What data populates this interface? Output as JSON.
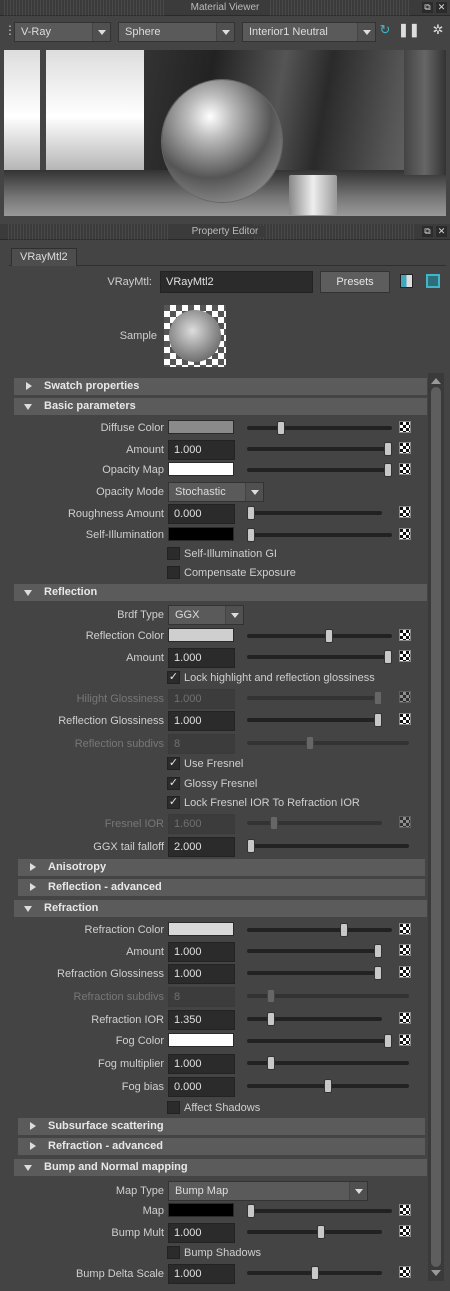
{
  "material_viewer": {
    "title": "Material Viewer",
    "renderer": "V-Ray",
    "geometry": "Sphere",
    "environment": "Interior1 Neutral"
  },
  "property_editor": {
    "title": "Property Editor",
    "tab": "VRayMtl2",
    "type_label": "VRayMtl:",
    "name": "VRayMtl2",
    "presets": "Presets",
    "sample_label": "Sample"
  },
  "frames": {
    "swatch": "Swatch properties",
    "basic": "Basic parameters",
    "reflection": "Reflection",
    "anisotropy": "Anisotropy",
    "reflection_adv": "Reflection - advanced",
    "refraction": "Refraction",
    "sss": "Subsurface scattering",
    "refraction_adv": "Refraction - advanced",
    "bump": "Bump and Normal mapping"
  },
  "basic": {
    "diffuse_color": {
      "label": "Diffuse Color",
      "swatch": "#8a8a8a",
      "level": 0.22
    },
    "amount": {
      "label": "Amount",
      "value": "1.000",
      "level": 1.0
    },
    "opacity_map": {
      "label": "Opacity Map",
      "swatch": "#ffffff",
      "level": 1.0
    },
    "opacity_mode": {
      "label": "Opacity Mode",
      "value": "Stochastic"
    },
    "roughness": {
      "label": "Roughness Amount",
      "value": "0.000",
      "level": 0.0
    },
    "self_illum": {
      "label": "Self-Illumination",
      "swatch": "#000000",
      "level": 0.0
    },
    "self_illum_gi": {
      "label": "Self-Illumination GI",
      "checked": false
    },
    "compensate": {
      "label": "Compensate Exposure",
      "checked": false
    }
  },
  "reflection": {
    "brdf": {
      "label": "Brdf Type",
      "value": "GGX"
    },
    "color": {
      "label": "Reflection Color",
      "swatch": "#cfcfcf",
      "level": 0.57
    },
    "amount": {
      "label": "Amount",
      "value": "1.000",
      "level": 1.0
    },
    "lock_hilight": {
      "label": "Lock highlight and reflection glossiness",
      "checked": true
    },
    "hilight_gloss": {
      "label": "Hilight Glossiness",
      "value": "1.000",
      "level": 1.0
    },
    "gloss": {
      "label": "Reflection Glossiness",
      "value": "1.000",
      "level": 1.0
    },
    "subdivs": {
      "label": "Reflection subdivs",
      "value": "8",
      "level": 0.38
    },
    "use_fresnel": {
      "label": "Use Fresnel",
      "checked": true
    },
    "glossy_fresnel": {
      "label": "Glossy Fresnel",
      "checked": true
    },
    "lock_ior": {
      "label": "Lock Fresnel IOR To Refraction IOR",
      "checked": true
    },
    "fresnel_ior": {
      "label": "Fresnel IOR",
      "value": "1.600",
      "level": 0.18
    },
    "ggx_tail": {
      "label": "GGX tail falloff",
      "value": "2.000",
      "level": 0.0
    }
  },
  "refraction": {
    "color": {
      "label": "Refraction Color",
      "swatch": "#d8d8d8",
      "level": 0.68
    },
    "amount": {
      "label": "Amount",
      "value": "1.000",
      "level": 1.0
    },
    "gloss": {
      "label": "Refraction Glossiness",
      "value": "1.000",
      "level": 1.0
    },
    "subdivs": {
      "label": "Refraction subdivs",
      "value": "8",
      "level": 0.13
    },
    "ior": {
      "label": "Refraction IOR",
      "value": "1.350",
      "level": 0.16
    },
    "fog_color": {
      "label": "Fog Color",
      "swatch": "#ffffff",
      "level": 1.0
    },
    "fog_mult": {
      "label": "Fog multiplier",
      "value": "1.000",
      "level": 0.13
    },
    "fog_bias": {
      "label": "Fog bias",
      "value": "0.000",
      "level": 0.5
    },
    "affect_shadows": {
      "label": "Affect Shadows",
      "checked": false
    }
  },
  "bump": {
    "map_type": {
      "label": "Map Type",
      "value": "Bump Map"
    },
    "map": {
      "label": "Map",
      "swatch": "#000000",
      "level": 0.0
    },
    "mult": {
      "label": "Bump Mult",
      "value": "1.000",
      "level": 0.55
    },
    "shadows": {
      "label": "Bump Shadows",
      "checked": false
    },
    "delta": {
      "label": "Bump Delta Scale",
      "value": "1.000",
      "level": 0.5
    }
  }
}
